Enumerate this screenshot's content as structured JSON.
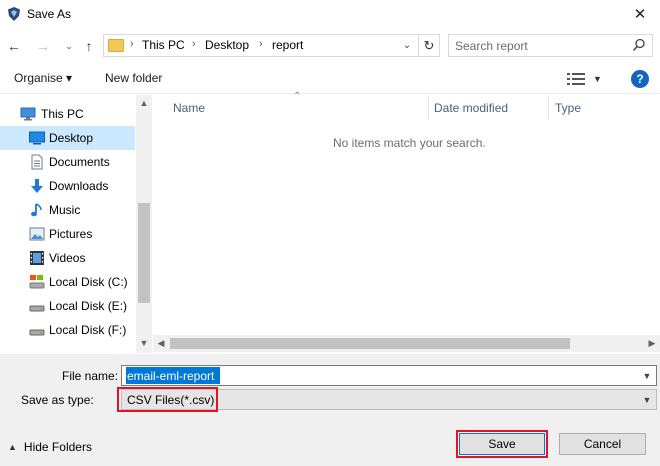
{
  "window": {
    "title": "Save As",
    "close_glyph": "✕",
    "icon": "app-shield-icon"
  },
  "navbar": {
    "back_glyph": "←",
    "forward_glyph": "→",
    "recent_glyph": "⌄",
    "up_glyph": "↑",
    "breadcrumb": [
      "This PC",
      "Desktop",
      "report"
    ],
    "separator": "›",
    "dropdown_glyph": "⌄",
    "refresh_glyph": "↻",
    "search_placeholder": "Search report"
  },
  "toolbar": {
    "organise_label": "Organise ▾",
    "new_folder_label": "New folder",
    "help_glyph": "?"
  },
  "nav_pane": {
    "items": [
      {
        "label": "This PC",
        "icon": "computer-icon"
      },
      {
        "label": "Desktop",
        "icon": "desktop-icon",
        "selected": true
      },
      {
        "label": "Documents",
        "icon": "documents-icon"
      },
      {
        "label": "Downloads",
        "icon": "downloads-icon"
      },
      {
        "label": "Music",
        "icon": "music-icon"
      },
      {
        "label": "Pictures",
        "icon": "pictures-icon"
      },
      {
        "label": "Videos",
        "icon": "videos-icon"
      },
      {
        "label": "Local Disk (C:)",
        "icon": "local-disk-c-icon"
      },
      {
        "label": "Local Disk (E:)",
        "icon": "drive-icon"
      },
      {
        "label": "Local Disk (F:)",
        "icon": "drive-icon"
      }
    ]
  },
  "file_list": {
    "columns": [
      "Name",
      "Date modified",
      "Type"
    ],
    "empty_message": "No items match your search."
  },
  "bottom": {
    "file_name_label": "File name:",
    "file_name_value": "email-eml-report",
    "save_type_label": "Save as type:",
    "save_type_value": "CSV Files(*.csv)",
    "hide_folders_label": "Hide Folders",
    "save_label": "Save",
    "cancel_label": "Cancel"
  },
  "colors": {
    "accent": "#0078d7",
    "highlight": "#e81123",
    "selected_bg": "#cce8ff",
    "header_text": "#4c607a"
  }
}
